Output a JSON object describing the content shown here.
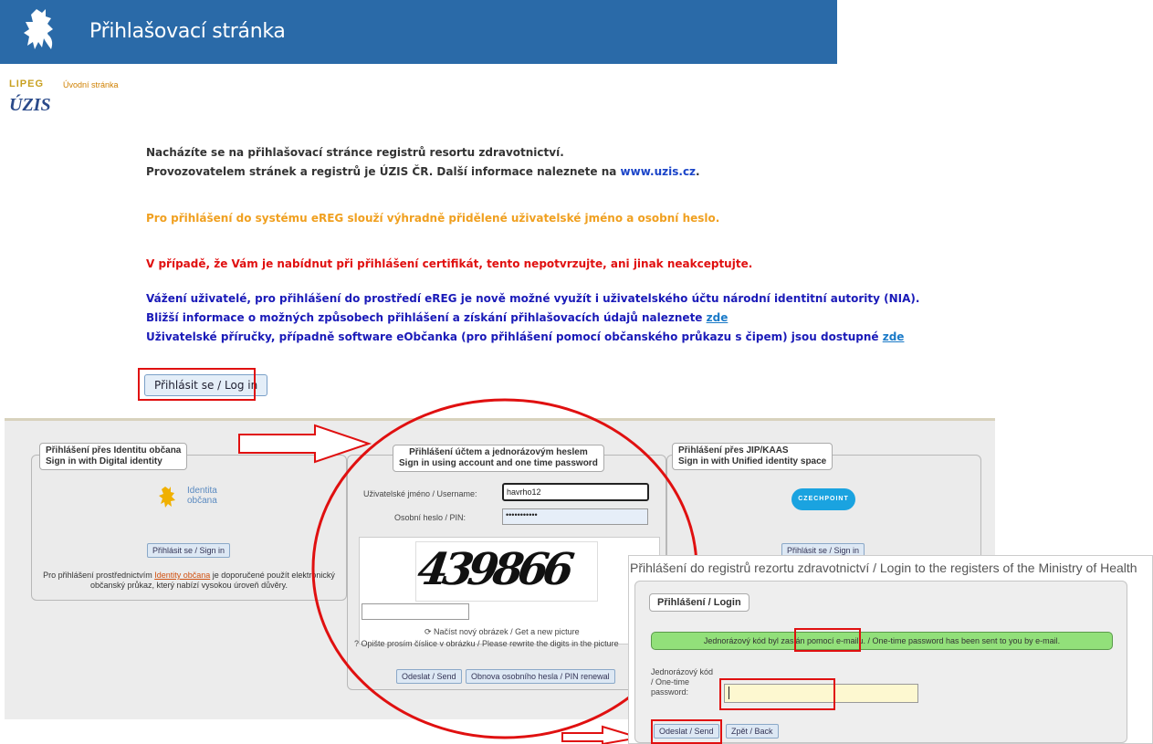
{
  "header": {
    "title": "Přihlašovací stránka"
  },
  "logo": {
    "top_text": "LIPEG",
    "brand": "ÚZIS",
    "home_link": "Úvodní stránka"
  },
  "intro": {
    "line1": "Nacházíte se na přihlašovací stránce registrů resortu zdravotnictví.",
    "line2_prefix": "Provozovatelem stránek a registrů je ÚZIS ČR. Další informace naleznete na ",
    "line2_link": "www.uzis.cz",
    "line2_suffix": ".",
    "orange": "Pro přihlášení do systému eREG slouží výhradně přidělené uživatelské jméno a osobní heslo.",
    "red": "V případě, že Vám je nabídnut při přihlášení certifikát, tento nepotvrzujte, ani jinak neakceptujte.",
    "blue1": "Vážení uživatelé, pro přihlášení do prostředí eREG je nově možné využít i uživatelského účtu národní identitní autority (NIA).",
    "blue2_prefix": "Bližší informace o možných způsobech přihlášení a získání přihlašovacích údajů naleznete ",
    "blue3_prefix": "Uživatelské příručky, případně software eObčanka (pro přihlášení pomocí občanského průkazu s čipem) jsou dostupné ",
    "zde": "zde",
    "login_button": "Přihlásit se / Log in"
  },
  "nia": {
    "legend_l1": "Přihlášení přes Identitu občana",
    "legend_l2": "Sign in with Digital identity",
    "logo_l1": "Identita",
    "logo_l2": "občana",
    "button": "Přihlásit se / Sign in",
    "desc_prefix": "Pro přihlášení prostřednictvím ",
    "desc_link": "Identity občana",
    "desc_suffix": " je doporučené použít elektronický občanský průkaz, který nabízí vysokou úroveň důvěry."
  },
  "otp": {
    "legend_l1": "Přihlášení účtem a jednorázovým heslem",
    "legend_l2": "Sign in using account and one time password",
    "username_label": "Uživatelské jméno / Username:",
    "username_value": "havrho12",
    "pin_label": "Osobní heslo / PIN:",
    "pin_value": "•••••••••••",
    "captcha": "439866",
    "reload": "⟳ Načíst nový obrázek / Get a new picture",
    "hint": "? Opište prosím číslice v obrázku / Please rewrite the digits in the picture",
    "send": "Odeslat / Send",
    "renew": "Obnova osobního hesla / PIN renewal"
  },
  "jip": {
    "legend_l1": "Přihlášení přes JIP/KAAS",
    "legend_l2": "Sign in with Unified identity space",
    "logo": "CZECHPOINT",
    "button": "Přihlásit se / Sign in"
  },
  "overlay": {
    "title": "Přihlášení do registrů rezortu zdravotnictví / Login to the registers of the Ministry of Health",
    "legend": "Přihlášení / Login",
    "message": "Jednorázový kód byl zaslán pomocí e-mailu. / One-time password has been sent to you by e-mail.",
    "code_label": "Jednorázový kód / One-time password:",
    "send": "Odeslat / Send",
    "back": "Zpět / Back"
  },
  "colors": {
    "header": "#2a6aa8",
    "orange": "#f0a020",
    "red": "#e01010",
    "blue": "#1a1ab8",
    "success": "#92e07a"
  }
}
